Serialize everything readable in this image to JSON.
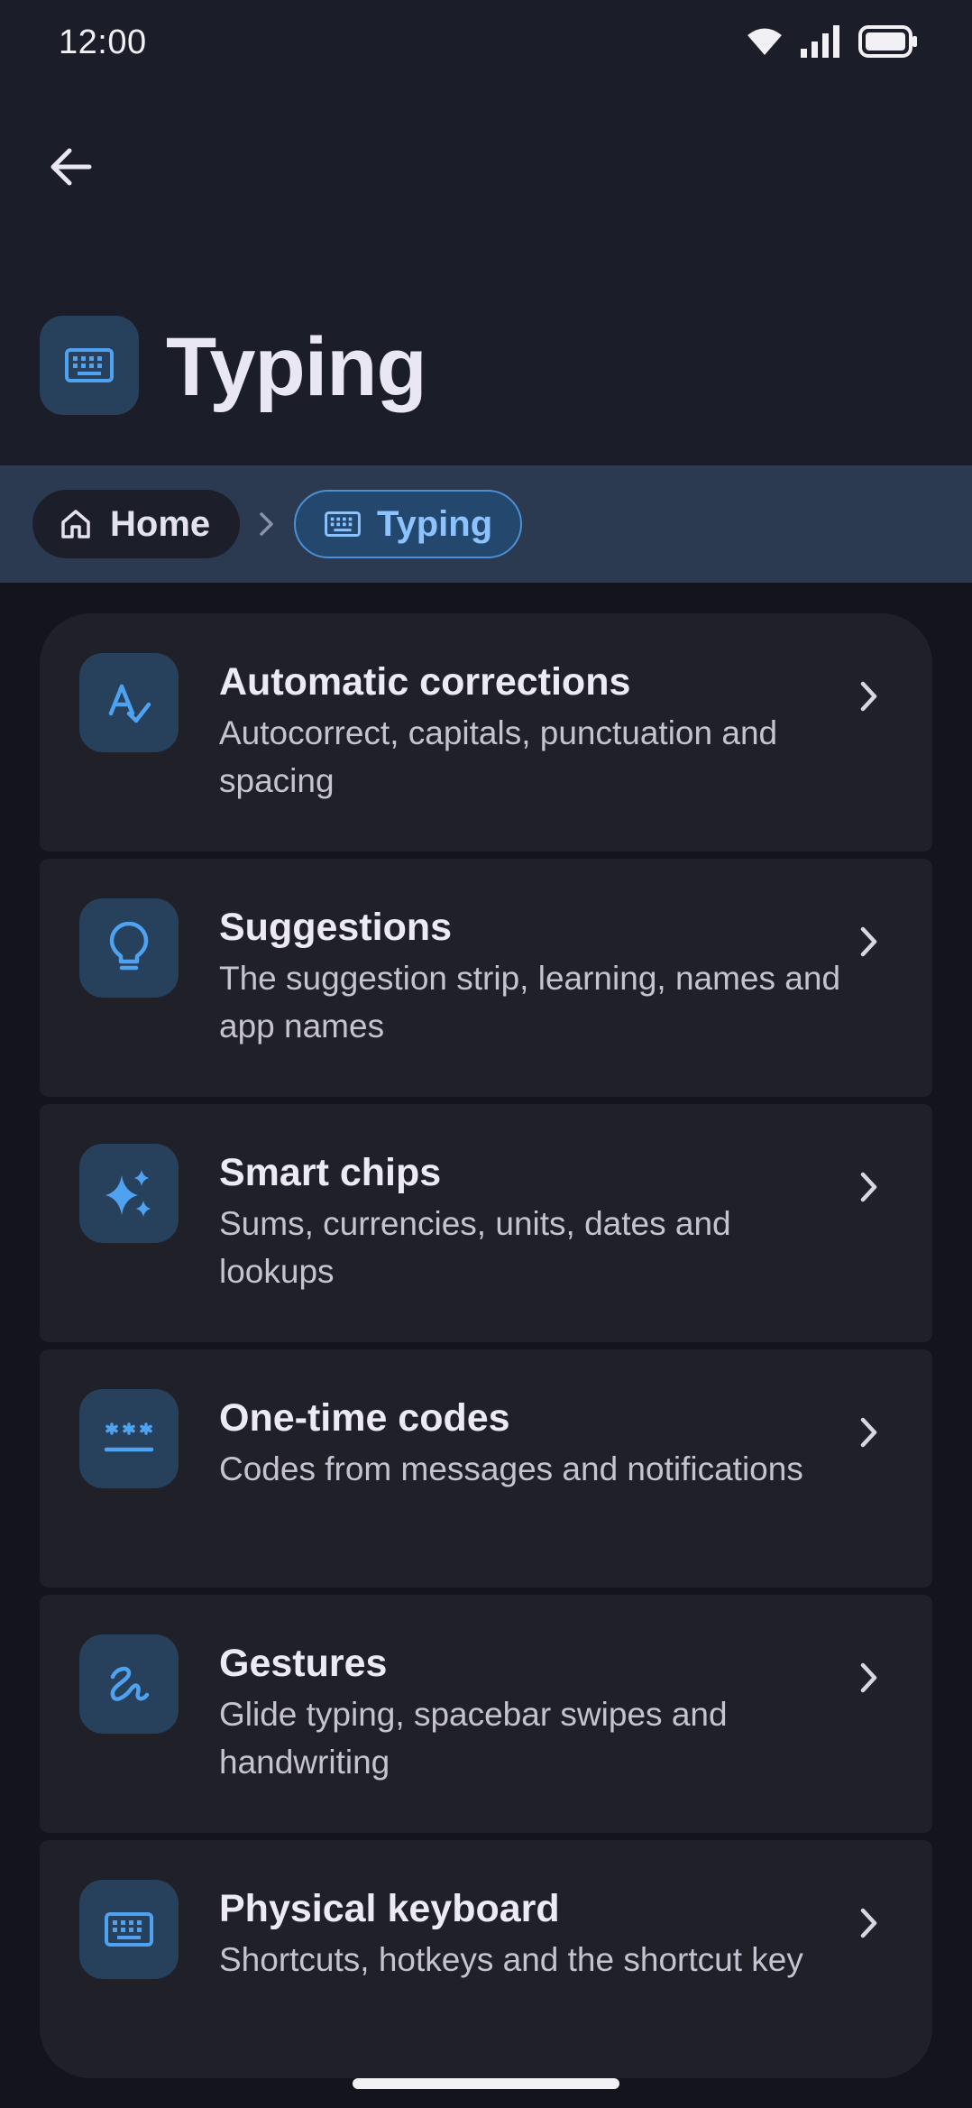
{
  "status_bar": {
    "time": "12:00"
  },
  "header": {
    "title": "Typing"
  },
  "breadcrumb": {
    "home_label": "Home",
    "current_label": "Typing"
  },
  "items": [
    {
      "title": "Automatic corrections",
      "subtitle": "Autocorrect, capitals, punctuation and spacing",
      "icon": "spellcheck-icon"
    },
    {
      "title": "Suggestions",
      "subtitle": "The suggestion strip, learning, names and app names",
      "icon": "lightbulb-icon"
    },
    {
      "title": "Smart chips",
      "subtitle": "Sums, currencies, units, dates and lookups",
      "icon": "sparkles-icon"
    },
    {
      "title": "One-time codes",
      "subtitle": "Codes from messages and notifications",
      "icon": "password-icon"
    },
    {
      "title": "Gestures",
      "subtitle": "Glide typing, spacebar swipes and handwriting",
      "icon": "gesture-icon"
    },
    {
      "title": "Physical keyboard",
      "subtitle": "Shortcuts, hotkeys and the shortcut key",
      "icon": "keyboard-icon"
    }
  ],
  "colors": {
    "accent": "#4ea2f0",
    "icon_tile": "#27405c",
    "breadcrumb_bar": "#2b3a50",
    "row_bg": "#202029"
  }
}
